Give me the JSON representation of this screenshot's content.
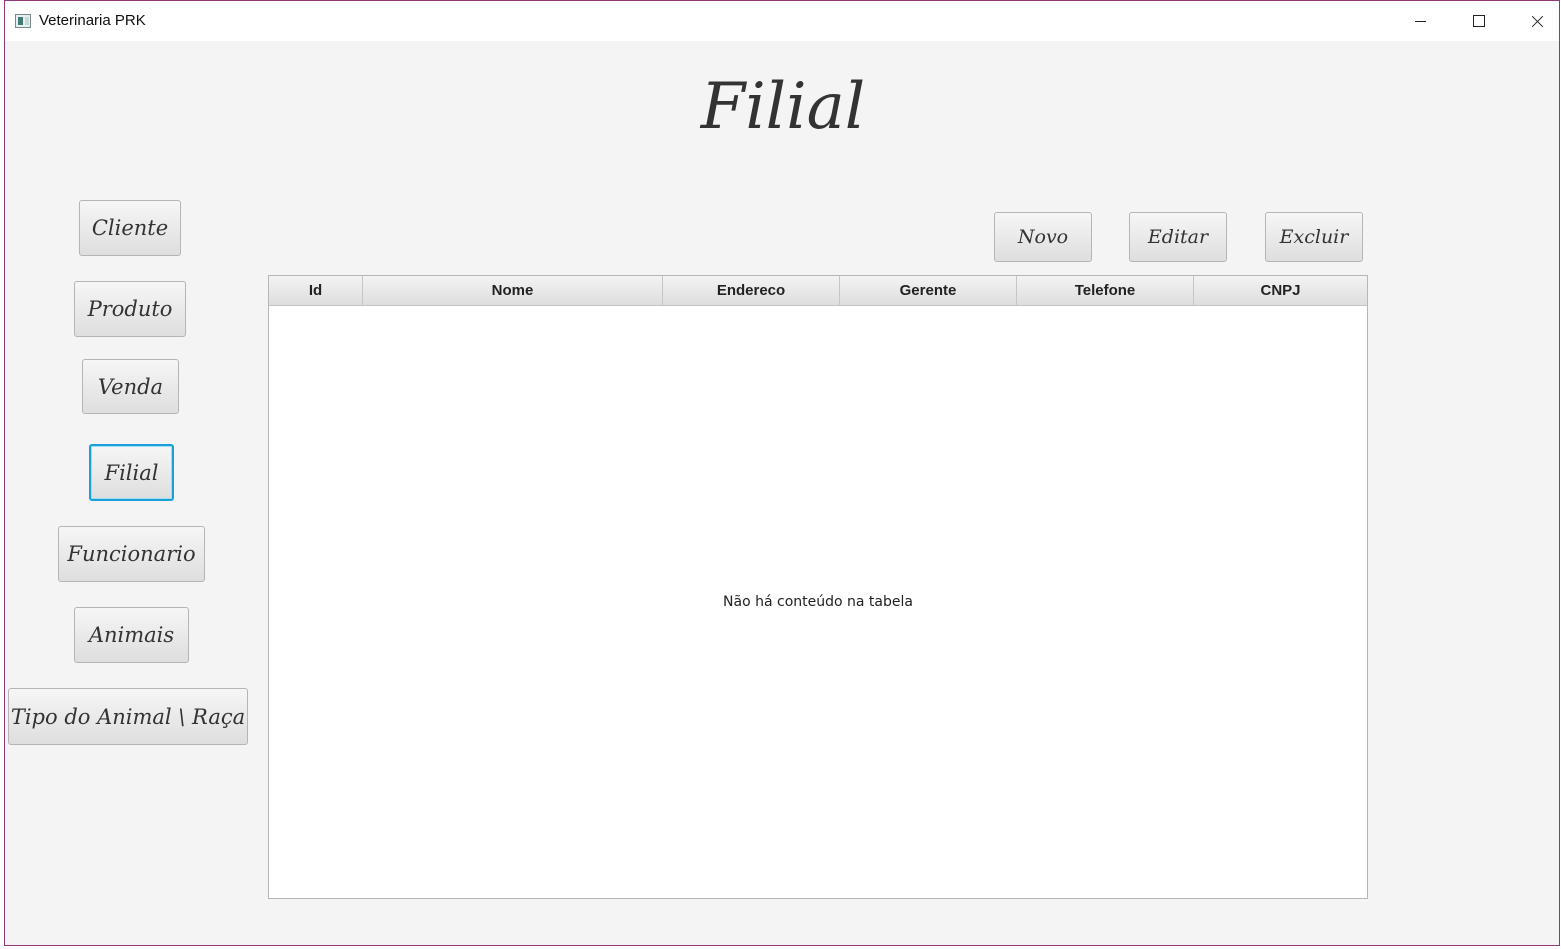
{
  "window": {
    "title": "Veterinaria PRK"
  },
  "page": {
    "title": "Filial"
  },
  "sidebar": {
    "items": [
      {
        "label": "Cliente"
      },
      {
        "label": "Produto"
      },
      {
        "label": "Venda"
      },
      {
        "label": "Filial",
        "selected": true
      },
      {
        "label": "Funcionario"
      },
      {
        "label": "Animais"
      },
      {
        "label": "Tipo do Animal \\ Raça"
      }
    ]
  },
  "toolbar": {
    "new_label": "Novo",
    "edit_label": "Editar",
    "delete_label": "Excluir"
  },
  "table": {
    "columns": [
      "Id",
      "Nome",
      "Endereco",
      "Gerente",
      "Telefone",
      "CNPJ"
    ],
    "rows": [],
    "empty_message": "Não há conteúdo na tabela"
  },
  "colors": {
    "focus": "#1a9fd6",
    "window_border": "#8e3a78",
    "background": "#f4f4f4"
  }
}
